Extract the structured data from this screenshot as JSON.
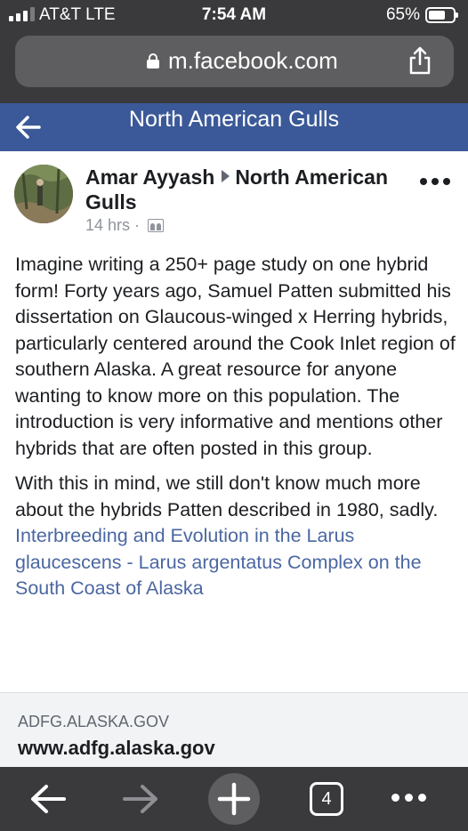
{
  "status_bar": {
    "carrier": "AT&T  LTE",
    "time": "7:54 AM",
    "battery_percent": "65%",
    "signal_bars_filled": 3,
    "battery_level": 0.65
  },
  "browser": {
    "url": "m.facebook.com",
    "tab_count": "4"
  },
  "group_header": {
    "title": "North American Gulls"
  },
  "post": {
    "author": "Amar Ayyash",
    "group": "North American Gulls",
    "time": "14 hrs",
    "separator": "·",
    "paragraphs": [
      "Imagine writing a 250+ page study on one hybrid form! Forty years ago, Samuel Patten submitted his dissertation on Glaucous-winged x Herring hybrids, particularly centered around the Cook Inlet region of southern Alaska. A great resource for anyone wanting to know more on this population. The introduction is very informative and mentions other hybrids that are often posted in this group.",
      "With this in mind, we still don't know much more about the hybrids Patten described in 1980, sadly."
    ],
    "link_text": "Interbreeding and Evolution in the Larus glaucescens - Larus argentatus Complex on the South Coast of Alaska"
  },
  "link_preview": {
    "domain": "ADFG.ALASKA.GOV",
    "url": "www.adfg.alaska.gov"
  },
  "icons": {
    "share": "share-icon",
    "back": "arrow-left-icon",
    "forward": "arrow-right-icon",
    "new_tab": "plus-icon",
    "more": "more-dots-icon"
  },
  "colors": {
    "facebook_blue": "#3b5998",
    "link_blue": "#4b67a1",
    "browser_chrome": "#3a3a3c"
  }
}
